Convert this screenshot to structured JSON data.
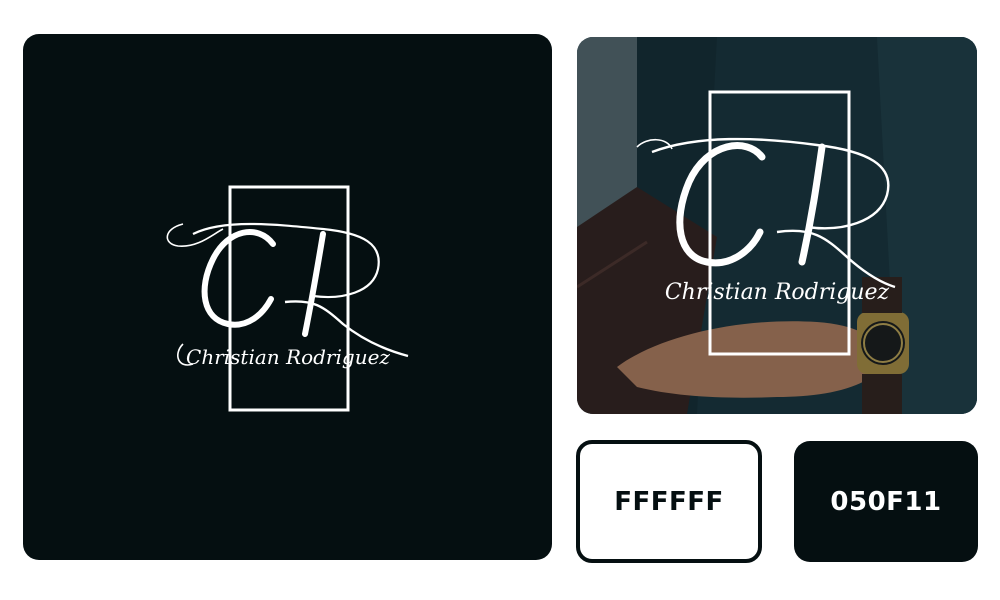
{
  "logo": {
    "monogram": "CR",
    "name_signature": "Christian Rodriguez"
  },
  "colors": {
    "background": "#ffffff",
    "logo_dark": "#050f11",
    "logo_light": "#ffffff"
  },
  "swatches": [
    {
      "label": "FFFFFF",
      "color": "#ffffff"
    },
    {
      "label": "050F11",
      "color": "#050f11"
    }
  ]
}
